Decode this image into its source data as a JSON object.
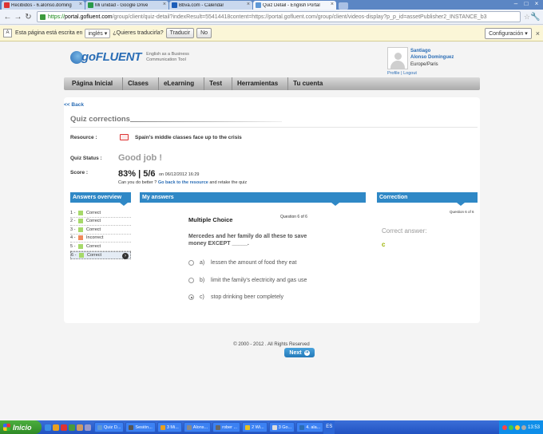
{
  "browser": {
    "tabs": [
      {
        "label": "Recibidos - 6.alonso.doming",
        "color": "#d33"
      },
      {
        "label": "Mi unidad - Google Drive",
        "color": "#2a9a4a"
      },
      {
        "label": "Bbva.com - Calendar",
        "color": "#1c5db8"
      },
      {
        "label": "Quiz Detail - English Portal",
        "color": "#5e98d6"
      }
    ],
    "url_scheme": "https://",
    "url_host": "portal.gofluent.com",
    "url_rest": "/group/client/quiz-detail?indexResult=55414418content=https://portal.gofluent.com/group/client/videos-display?p_p_id=assetPublisher2_INSTANCE_b3"
  },
  "translate_bar": {
    "prefix": "Esta página está escrita en",
    "language": "inglés",
    "question": "¿Quieres traducirla?",
    "translate_btn": "Traducir",
    "no_btn": "No",
    "config_btn": "Configuración"
  },
  "header": {
    "brand": "goFLUENT",
    "tagline": "English as a Business Communication Tool",
    "user_first": "Santiago",
    "user_last": "Alonso Dominguez",
    "location": "Europe/Paris",
    "link_profile": "Profile",
    "link_logout": "Logout"
  },
  "nav": [
    "Página Inicial",
    "Clases",
    "eLearning",
    "Test",
    "Herramientas",
    "Tu cuenta"
  ],
  "quiz": {
    "back": "<< Back",
    "title": "Quiz corrections",
    "resource_label": "Resource :",
    "resource_title": "Spain's middle classes face up to the crisis",
    "status_label": "Quiz Status :",
    "status_value": "Good job !",
    "score_label": "Score :",
    "score_value": "83% | 5/6",
    "score_date": "on 06/12/2012 16:29",
    "retry_prefix": "Can you do better ?",
    "retry_link": "Go back to the resource",
    "retry_suffix": "and retake the quiz"
  },
  "panels": {
    "overview": "Answers overview",
    "my_answers": "My answers",
    "correction": "Correction"
  },
  "answers": [
    {
      "num": "1 -",
      "result": "Correct",
      "color": "#a6d96a"
    },
    {
      "num": "2 -",
      "result": "Correct",
      "color": "#a6d96a"
    },
    {
      "num": "3 -",
      "result": "Correct",
      "color": "#a6d96a"
    },
    {
      "num": "4 -",
      "result": "Incorrect",
      "color": "#f08a5d"
    },
    {
      "num": "5 -",
      "result": "Correct",
      "color": "#a6d96a"
    },
    {
      "num": "6 -",
      "result": "Correct",
      "color": "#a6d96a"
    }
  ],
  "question": {
    "type": "Multiple Choice",
    "number": "Question 6 of 6",
    "text": "Mercedes and her family do all these to save money EXCEPT _____.",
    "options": [
      {
        "letter": "a)",
        "text": "lessen the amount of food they eat"
      },
      {
        "letter": "b)",
        "text": "limit the family's electricity and gas use"
      },
      {
        "letter": "c)",
        "text": "stop drinking beer completely"
      }
    ],
    "next": "Next"
  },
  "correction": {
    "number": "Question 6 of 6",
    "label": "Correct answer:",
    "value": "c"
  },
  "footer": "© 2000 - 2012 . All Rights Reserved",
  "taskbar": {
    "start": "Inicio",
    "items": [
      {
        "label": "Quiz D...",
        "color": "#5e98d6"
      },
      {
        "label": "Sesión...",
        "color": "#555"
      },
      {
        "label": "3 Mi...",
        "color": "#e8a020"
      },
      {
        "label": "Alons...",
        "color": "#888"
      },
      {
        "label": "rober ...",
        "color": "#666"
      },
      {
        "label": "2 Wi...",
        "color": "#e8c020"
      },
      {
        "label": "3 Go...",
        "color": "#ddd"
      },
      {
        "label": "4. ala...",
        "color": "#2a6db5"
      }
    ],
    "lang": "ES",
    "clock": "13:53"
  }
}
